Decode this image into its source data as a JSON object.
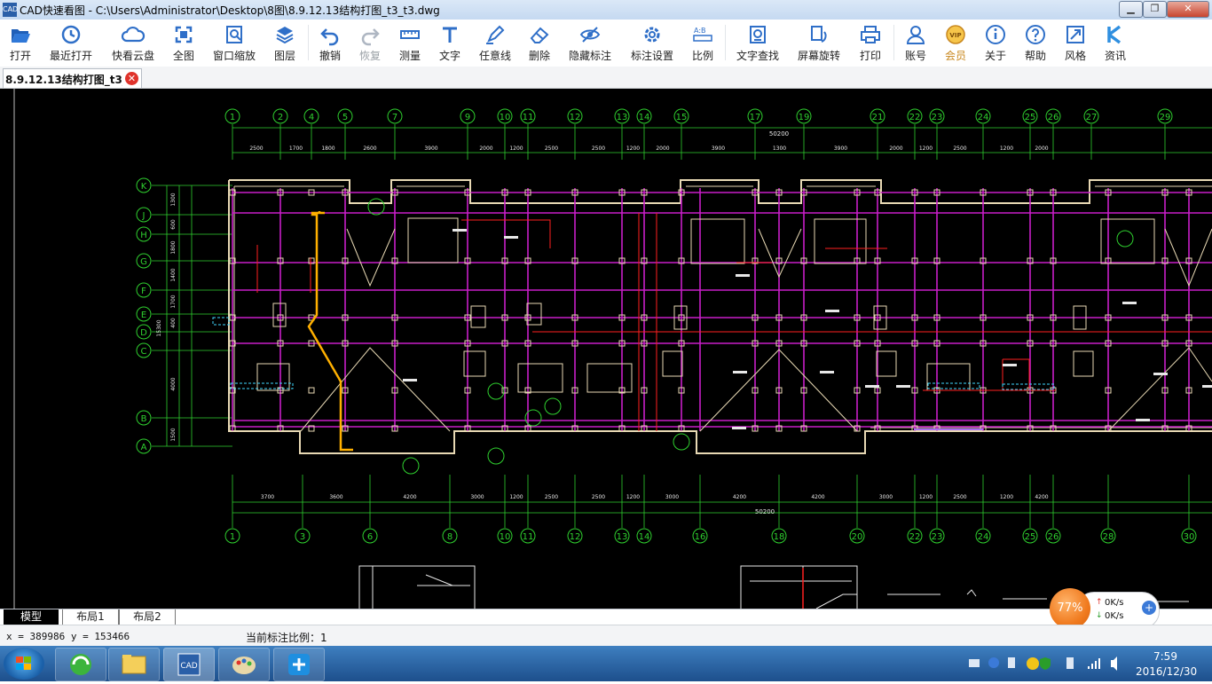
{
  "window": {
    "title": "CAD快速看图 - C:\\Users\\Administrator\\Desktop\\8图\\8.9.12.13结构打图_t3_t3.dwg",
    "logo_text": "CAD",
    "min_symbol": "▁",
    "max_symbol": "❐",
    "close_symbol": "✕"
  },
  "toolbar": {
    "items": [
      {
        "label": "打开",
        "icon": "folder-open-icon"
      },
      {
        "label": "最近打开",
        "icon": "recent-clock-icon"
      },
      {
        "label": "快看云盘",
        "icon": "cloud-icon"
      },
      {
        "label": "全图",
        "icon": "fullview-icon"
      },
      {
        "label": "窗口缩放",
        "icon": "window-zoom-icon"
      },
      {
        "label": "图层",
        "icon": "layers-icon"
      },
      {
        "label": "撤销",
        "icon": "undo-icon"
      },
      {
        "label": "恢复",
        "icon": "redo-icon"
      },
      {
        "label": "测量",
        "icon": "ruler-icon"
      },
      {
        "label": "文字",
        "icon": "text-icon"
      },
      {
        "label": "任意线",
        "icon": "pen-icon"
      },
      {
        "label": "删除",
        "icon": "eraser-icon"
      },
      {
        "label": "隐藏标注",
        "icon": "eye-hide-icon"
      },
      {
        "label": "标注设置",
        "icon": "settings-icon"
      },
      {
        "label": "比例",
        "icon": "scale-icon"
      },
      {
        "label": "文字查找",
        "icon": "text-search-icon"
      },
      {
        "label": "屏幕旋转",
        "icon": "rotate-icon"
      },
      {
        "label": "打印",
        "icon": "printer-icon"
      },
      {
        "label": "账号",
        "icon": "user-icon"
      },
      {
        "label": "会员",
        "icon": "vip-icon"
      },
      {
        "label": "关于",
        "icon": "info-icon"
      },
      {
        "label": "帮助",
        "icon": "help-icon"
      },
      {
        "label": "风格",
        "icon": "style-icon"
      },
      {
        "label": "资讯",
        "icon": "news-icon"
      }
    ],
    "vip_badge": "VIP"
  },
  "document_tab": {
    "label": "8.9.12.13结构打图_t3_t3.dwg",
    "close_symbol": "✕"
  },
  "drawing": {
    "top_axes": [
      "1",
      "2",
      "4",
      "5",
      "7",
      "9",
      "10",
      "11",
      "12",
      "13",
      "14",
      "15",
      "17",
      "19",
      "21",
      "22",
      "23",
      "24",
      "25",
      "26",
      "27",
      "29"
    ],
    "bottom_axes": [
      "1",
      "3",
      "6",
      "8",
      "10",
      "11",
      "12",
      "13",
      "14",
      "16",
      "18",
      "20",
      "22",
      "23",
      "24",
      "25",
      "26",
      "28",
      "30"
    ],
    "row_axes": [
      "K",
      "J",
      "H",
      "G",
      "F",
      "E",
      "D",
      "C",
      "B",
      "A"
    ],
    "top_total_dim": "50200",
    "bottom_total_dim": "50200",
    "top_dims": [
      "2500",
      "1700",
      "1800",
      "2600",
      "3900",
      "2000",
      "1200",
      "2500",
      "2500",
      "1200",
      "2000",
      "3900",
      "1300",
      "3900",
      "2000",
      "1200",
      "2500",
      "1200",
      "2000"
    ],
    "bottom_dims": [
      "3700",
      "3600",
      "4200",
      "3000",
      "1200",
      "2500",
      "2500",
      "1200",
      "3000",
      "4200",
      "4200",
      "3000",
      "1200",
      "2500",
      "1200",
      "4200"
    ],
    "left_dims": [
      "1300",
      "600",
      "1800",
      "1400",
      "1700",
      "400",
      "15300",
      "4000",
      "1500"
    ],
    "colors": {
      "axis": "#2fd02f",
      "wall": "#e8d9b4",
      "beam": "#c81ec8",
      "rebar": "#ff2020",
      "highlight": "#ffb000",
      "text": "#e8e8e8",
      "cyan": "#40d8ff"
    }
  },
  "layout_tabs": [
    "模型",
    "布局1",
    "布局2"
  ],
  "status": {
    "coordinates": "x = 389986  y = 153466",
    "scale": "当前标注比例：1"
  },
  "speed_widget": {
    "percent": "77%",
    "upload": "0K/s",
    "download": "0K/s",
    "plus": "+"
  },
  "taskbar": {
    "time": "7:59",
    "date": "2016/12/30",
    "apps": [
      "browser-icon",
      "explorer-icon",
      "cad-app-icon",
      "paint-icon",
      "plus-app-icon"
    ]
  }
}
